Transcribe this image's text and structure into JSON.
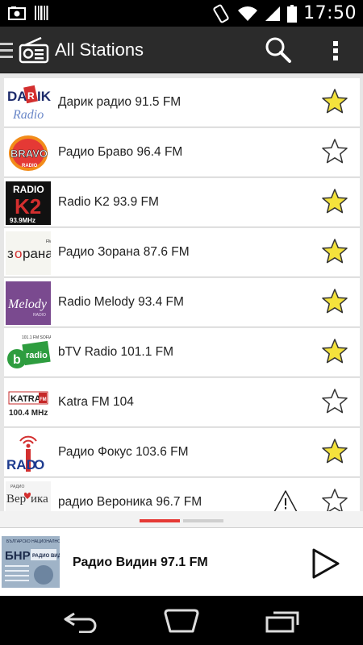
{
  "status_bar": {
    "time": "17:50",
    "icons": [
      "photo-icon",
      "barcode-icon",
      "vibrate-icon",
      "wifi-icon",
      "signal-icon",
      "battery-icon"
    ]
  },
  "action_bar": {
    "title": "All Stations",
    "icons": [
      "drawer-icon",
      "radio-app-icon",
      "search-icon",
      "overflow-menu-icon"
    ]
  },
  "stations": [
    {
      "name": "Дарик радио 91.5 FM",
      "logo_text": "DARIK Radio",
      "favorite": true,
      "warning": false
    },
    {
      "name": "Радио Браво 96.4 FM",
      "logo_text": "BRAVO RADIO",
      "favorite": false,
      "warning": false
    },
    {
      "name": "Radio K2 93.9 FM",
      "logo_text": "RADIO K2 93.9MHz",
      "favorite": true,
      "warning": false
    },
    {
      "name": "Радио Зорана 87.6 FM",
      "logo_text": "зорана FM",
      "favorite": true,
      "warning": false
    },
    {
      "name": "Radio Melody 93.4 FM",
      "logo_text": "Melody",
      "favorite": true,
      "warning": false
    },
    {
      "name": "bTV Radio 101.1 FM",
      "logo_text": "b radio 101.1 FM SOFIA",
      "favorite": true,
      "warning": false
    },
    {
      "name": "Katra FM 104",
      "logo_text": "KATRA FM 100.4 MHz",
      "favorite": false,
      "warning": false
    },
    {
      "name": "Радио Фокус 103.6 FM",
      "logo_text": "RADIO FOCUS",
      "favorite": true,
      "warning": false
    },
    {
      "name": "радио Вероника 96.7 FM",
      "logo_text": "Вероника",
      "favorite": false,
      "warning": true
    }
  ],
  "pager": {
    "active_index": 0,
    "count": 2
  },
  "now_playing": {
    "title": "Радио Видин 97.1 FM",
    "logo_text": "БНР РАДИО ВИДИН"
  },
  "colors": {
    "accent": "#e53935",
    "star_fill": "#f4e23c",
    "action_bar": "#2b2b2b"
  },
  "nav_bar": {
    "icons": [
      "back-icon",
      "home-icon",
      "recent-apps-icon"
    ]
  }
}
